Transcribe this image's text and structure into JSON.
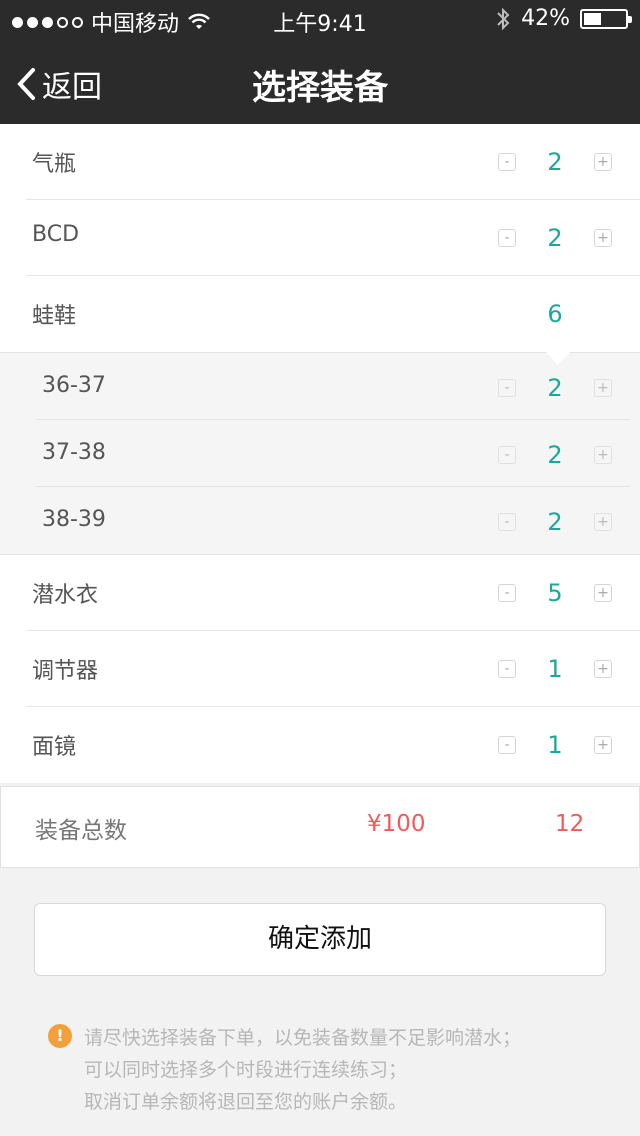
{
  "status_bar": {
    "carrier": "中国移动",
    "time": "上午9:41",
    "battery": "42%",
    "battery_level": 0.42
  },
  "nav": {
    "back_label": "返回",
    "title": "选择装备"
  },
  "items": [
    {
      "label": "气瓶",
      "qty": "2"
    },
    {
      "label": "BCD",
      "qty": "2"
    },
    {
      "label": "蛙鞋",
      "qty": "6"
    },
    {
      "label": "潜水衣",
      "qty": "5"
    },
    {
      "label": "调节器",
      "qty": "1"
    },
    {
      "label": "面镜",
      "qty": "1"
    }
  ],
  "fin_sizes": [
    {
      "label": "36-37",
      "qty": "2"
    },
    {
      "label": "37-38",
      "qty": "2"
    },
    {
      "label": "38-39",
      "qty": "2"
    }
  ],
  "stepper": {
    "minus": "-",
    "plus": "+"
  },
  "total": {
    "label": "装备总数",
    "price": "¥100",
    "count": "12"
  },
  "confirm_label": "确定添加",
  "notes": {
    "icon": "!",
    "lines": [
      "请尽快选择装备下单，以免装备数量不足影响潜水；",
      "可以同时选择多个时段进行连续练习；",
      "取消订单余额将退回至您的账户余额。"
    ]
  },
  "colors": {
    "accent": "#1aa89a",
    "price": "#f05a5a",
    "warning": "#f2a03b",
    "nav_bg": "#2b2b2b"
  }
}
